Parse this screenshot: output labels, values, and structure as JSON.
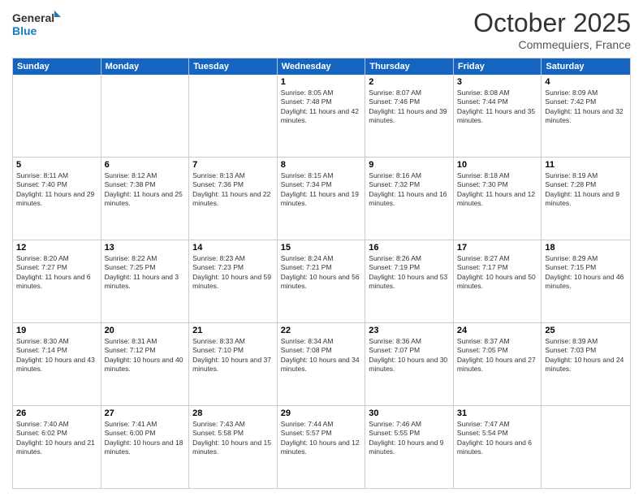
{
  "logo": {
    "line1": "General",
    "line2": "Blue"
  },
  "header": {
    "month": "October 2025",
    "location": "Commequiers, France"
  },
  "weekdays": [
    "Sunday",
    "Monday",
    "Tuesday",
    "Wednesday",
    "Thursday",
    "Friday",
    "Saturday"
  ],
  "rows": [
    [
      {
        "day": "",
        "sunrise": "",
        "sunset": "",
        "daylight": ""
      },
      {
        "day": "",
        "sunrise": "",
        "sunset": "",
        "daylight": ""
      },
      {
        "day": "",
        "sunrise": "",
        "sunset": "",
        "daylight": ""
      },
      {
        "day": "1",
        "sunrise": "Sunrise: 8:05 AM",
        "sunset": "Sunset: 7:48 PM",
        "daylight": "Daylight: 11 hours and 42 minutes."
      },
      {
        "day": "2",
        "sunrise": "Sunrise: 8:07 AM",
        "sunset": "Sunset: 7:46 PM",
        "daylight": "Daylight: 11 hours and 39 minutes."
      },
      {
        "day": "3",
        "sunrise": "Sunrise: 8:08 AM",
        "sunset": "Sunset: 7:44 PM",
        "daylight": "Daylight: 11 hours and 35 minutes."
      },
      {
        "day": "4",
        "sunrise": "Sunrise: 8:09 AM",
        "sunset": "Sunset: 7:42 PM",
        "daylight": "Daylight: 11 hours and 32 minutes."
      }
    ],
    [
      {
        "day": "5",
        "sunrise": "Sunrise: 8:11 AM",
        "sunset": "Sunset: 7:40 PM",
        "daylight": "Daylight: 11 hours and 29 minutes."
      },
      {
        "day": "6",
        "sunrise": "Sunrise: 8:12 AM",
        "sunset": "Sunset: 7:38 PM",
        "daylight": "Daylight: 11 hours and 25 minutes."
      },
      {
        "day": "7",
        "sunrise": "Sunrise: 8:13 AM",
        "sunset": "Sunset: 7:36 PM",
        "daylight": "Daylight: 11 hours and 22 minutes."
      },
      {
        "day": "8",
        "sunrise": "Sunrise: 8:15 AM",
        "sunset": "Sunset: 7:34 PM",
        "daylight": "Daylight: 11 hours and 19 minutes."
      },
      {
        "day": "9",
        "sunrise": "Sunrise: 8:16 AM",
        "sunset": "Sunset: 7:32 PM",
        "daylight": "Daylight: 11 hours and 16 minutes."
      },
      {
        "day": "10",
        "sunrise": "Sunrise: 8:18 AM",
        "sunset": "Sunset: 7:30 PM",
        "daylight": "Daylight: 11 hours and 12 minutes."
      },
      {
        "day": "11",
        "sunrise": "Sunrise: 8:19 AM",
        "sunset": "Sunset: 7:28 PM",
        "daylight": "Daylight: 11 hours and 9 minutes."
      }
    ],
    [
      {
        "day": "12",
        "sunrise": "Sunrise: 8:20 AM",
        "sunset": "Sunset: 7:27 PM",
        "daylight": "Daylight: 11 hours and 6 minutes."
      },
      {
        "day": "13",
        "sunrise": "Sunrise: 8:22 AM",
        "sunset": "Sunset: 7:25 PM",
        "daylight": "Daylight: 11 hours and 3 minutes."
      },
      {
        "day": "14",
        "sunrise": "Sunrise: 8:23 AM",
        "sunset": "Sunset: 7:23 PM",
        "daylight": "Daylight: 10 hours and 59 minutes."
      },
      {
        "day": "15",
        "sunrise": "Sunrise: 8:24 AM",
        "sunset": "Sunset: 7:21 PM",
        "daylight": "Daylight: 10 hours and 56 minutes."
      },
      {
        "day": "16",
        "sunrise": "Sunrise: 8:26 AM",
        "sunset": "Sunset: 7:19 PM",
        "daylight": "Daylight: 10 hours and 53 minutes."
      },
      {
        "day": "17",
        "sunrise": "Sunrise: 8:27 AM",
        "sunset": "Sunset: 7:17 PM",
        "daylight": "Daylight: 10 hours and 50 minutes."
      },
      {
        "day": "18",
        "sunrise": "Sunrise: 8:29 AM",
        "sunset": "Sunset: 7:15 PM",
        "daylight": "Daylight: 10 hours and 46 minutes."
      }
    ],
    [
      {
        "day": "19",
        "sunrise": "Sunrise: 8:30 AM",
        "sunset": "Sunset: 7:14 PM",
        "daylight": "Daylight: 10 hours and 43 minutes."
      },
      {
        "day": "20",
        "sunrise": "Sunrise: 8:31 AM",
        "sunset": "Sunset: 7:12 PM",
        "daylight": "Daylight: 10 hours and 40 minutes."
      },
      {
        "day": "21",
        "sunrise": "Sunrise: 8:33 AM",
        "sunset": "Sunset: 7:10 PM",
        "daylight": "Daylight: 10 hours and 37 minutes."
      },
      {
        "day": "22",
        "sunrise": "Sunrise: 8:34 AM",
        "sunset": "Sunset: 7:08 PM",
        "daylight": "Daylight: 10 hours and 34 minutes."
      },
      {
        "day": "23",
        "sunrise": "Sunrise: 8:36 AM",
        "sunset": "Sunset: 7:07 PM",
        "daylight": "Daylight: 10 hours and 30 minutes."
      },
      {
        "day": "24",
        "sunrise": "Sunrise: 8:37 AM",
        "sunset": "Sunset: 7:05 PM",
        "daylight": "Daylight: 10 hours and 27 minutes."
      },
      {
        "day": "25",
        "sunrise": "Sunrise: 8:39 AM",
        "sunset": "Sunset: 7:03 PM",
        "daylight": "Daylight: 10 hours and 24 minutes."
      }
    ],
    [
      {
        "day": "26",
        "sunrise": "Sunrise: 7:40 AM",
        "sunset": "Sunset: 6:02 PM",
        "daylight": "Daylight: 10 hours and 21 minutes."
      },
      {
        "day": "27",
        "sunrise": "Sunrise: 7:41 AM",
        "sunset": "Sunset: 6:00 PM",
        "daylight": "Daylight: 10 hours and 18 minutes."
      },
      {
        "day": "28",
        "sunrise": "Sunrise: 7:43 AM",
        "sunset": "Sunset: 5:58 PM",
        "daylight": "Daylight: 10 hours and 15 minutes."
      },
      {
        "day": "29",
        "sunrise": "Sunrise: 7:44 AM",
        "sunset": "Sunset: 5:57 PM",
        "daylight": "Daylight: 10 hours and 12 minutes."
      },
      {
        "day": "30",
        "sunrise": "Sunrise: 7:46 AM",
        "sunset": "Sunset: 5:55 PM",
        "daylight": "Daylight: 10 hours and 9 minutes."
      },
      {
        "day": "31",
        "sunrise": "Sunrise: 7:47 AM",
        "sunset": "Sunset: 5:54 PM",
        "daylight": "Daylight: 10 hours and 6 minutes."
      },
      {
        "day": "",
        "sunrise": "",
        "sunset": "",
        "daylight": ""
      }
    ]
  ]
}
